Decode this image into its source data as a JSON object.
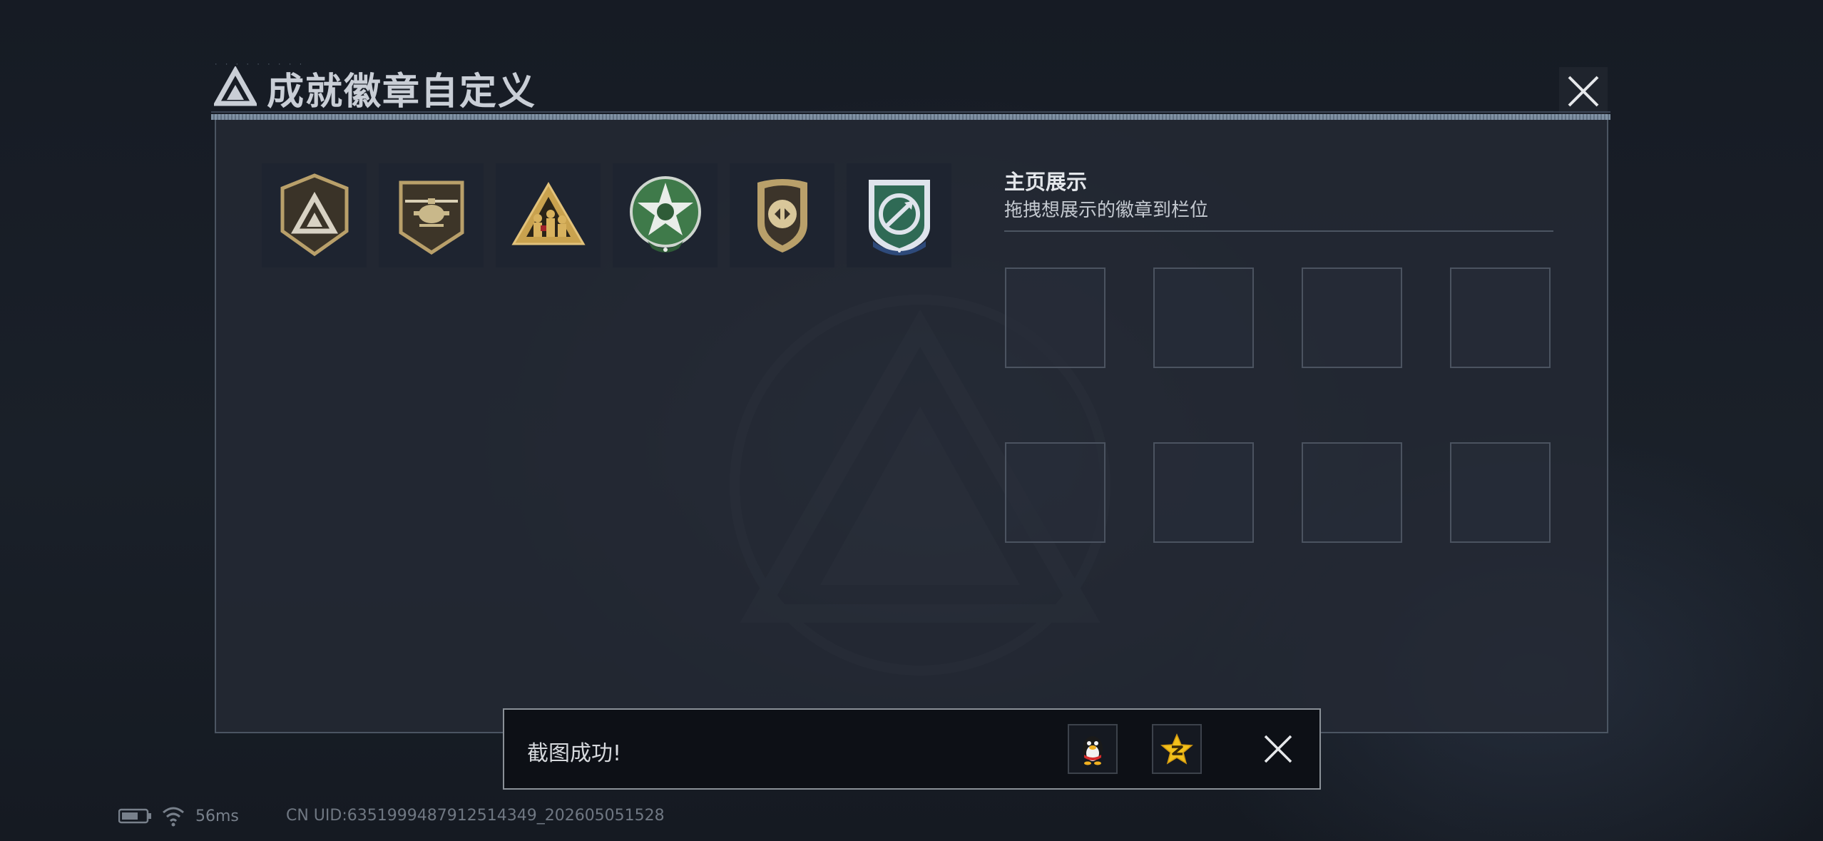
{
  "dialog": {
    "title": "成就徽章自定义",
    "close_icon": "close-icon"
  },
  "badges": [
    {
      "name": "triangle-logo-badge",
      "color": "#b9a06a"
    },
    {
      "name": "helicopter-badge",
      "color": "#b9a06a"
    },
    {
      "name": "soldiers-triangle-badge",
      "color": "#c9a24e"
    },
    {
      "name": "green-star-badge",
      "color": "#3f7a4a"
    },
    {
      "name": "shield-arrows-badge",
      "color": "#b9a06a"
    },
    {
      "name": "blue-arrows-badge",
      "color": "#2e4a7a"
    }
  ],
  "display": {
    "title": "主页展示",
    "subtitle": "拖拽想展示的徽章到栏位",
    "slot_count": 8
  },
  "toast": {
    "message": "截图成功!",
    "share_qq_icon": "qq-penguin-icon",
    "share_qzone_icon": "qzone-star-icon",
    "close_icon": "close-icon"
  },
  "status": {
    "battery_icon": "battery-icon",
    "wifi_icon": "wifi-icon",
    "latency": "56ms",
    "uid": "CN UID:6351999487912514349_202605051528"
  }
}
